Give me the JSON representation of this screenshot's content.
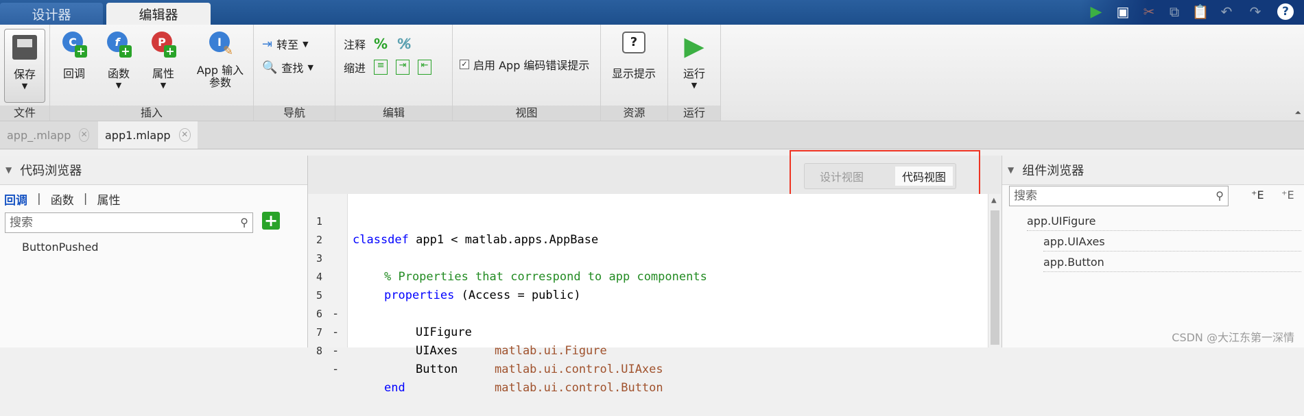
{
  "main_tabs": [
    "设计器",
    "编辑器"
  ],
  "ribbon": {
    "save": "保存",
    "file_section": "文件",
    "callback": "回调",
    "function": "函数",
    "property": "属性",
    "app_input": "App 输入",
    "app_input2": "参数",
    "insert_section": "插入",
    "goto": "转至",
    "find": "查找",
    "nav_section": "导航",
    "comment": "注释",
    "indent": "缩进",
    "edit_section": "编辑",
    "app_hint": "启用 App 编码错误提示",
    "view_section": "视图",
    "show_hint": "显示提示",
    "resource_section": "资源",
    "run": "运行",
    "run_section": "运行"
  },
  "doc_tabs": [
    "app_.mlapp",
    "app1.mlapp"
  ],
  "code_browser": {
    "title": "代码浏览器",
    "tabs": [
      "回调",
      "函数",
      "属性"
    ],
    "search_placeholder": "搜索",
    "items": [
      "ButtonPushed"
    ]
  },
  "view_switch": {
    "design": "设计视图",
    "code": "代码视图"
  },
  "code": {
    "line_numbers": [
      "1",
      "2",
      "3",
      "4",
      "5",
      "6",
      "7",
      "8"
    ],
    "l1_kw": "classdef",
    "l1_rest": " app1 < matlab.apps.AppBase",
    "l3": "% Properties that correspond to app components",
    "l4_kw": "properties",
    "l4_rest": " (Access = public)",
    "l5_name": "UIFigure",
    "l5_type": "matlab.ui.Figure",
    "l6_name": "UIAxes",
    "l6_type": "matlab.ui.control.UIAxes",
    "l7_name": "Button",
    "l7_type": "matlab.ui.control.Button",
    "l8_kw": "end"
  },
  "component_browser": {
    "title": "组件浏览器",
    "search_placeholder": "搜索",
    "items": [
      "app.UIFigure",
      "app.UIAxes",
      "app.Button"
    ]
  },
  "watermark": "CSDN @大江东第一深情"
}
